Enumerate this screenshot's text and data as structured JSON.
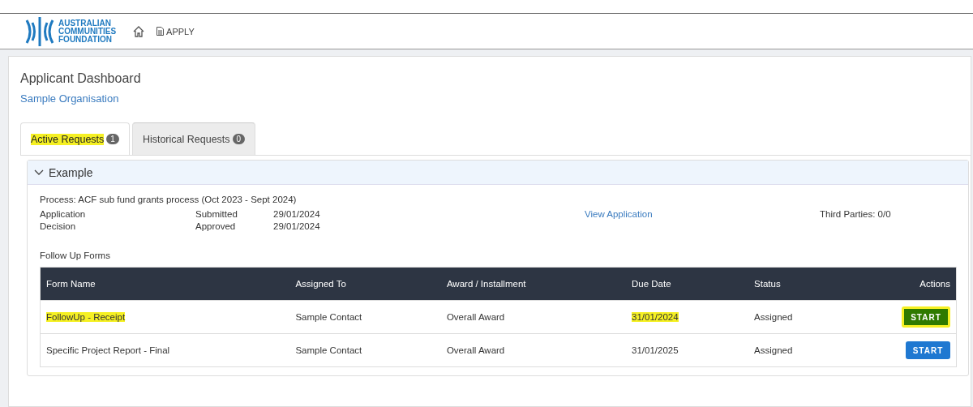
{
  "header": {
    "logo_lines": [
      "AUSTRALIAN",
      "COMMUNITIES",
      "FOUNDATION"
    ],
    "nav": [
      {
        "kind": "home"
      },
      {
        "kind": "link",
        "label": "APPLY"
      }
    ]
  },
  "page": {
    "title": "Applicant Dashboard",
    "organisation": "Sample Organisation"
  },
  "tabs": [
    {
      "label": "Active Requests",
      "count": "1",
      "selected": true,
      "highlighted": true
    },
    {
      "label": "Historical Requests",
      "count": "0",
      "selected": false,
      "highlighted": false
    }
  ],
  "section": {
    "title": "Example",
    "expanded": true,
    "process": "Process: ACF sub fund grants process (Oct 2023 - Sept 2024)",
    "stages": [
      {
        "name": "Application",
        "status": "Submitted",
        "date": "29/01/2024"
      },
      {
        "name": "Decision",
        "status": "Approved",
        "date": "29/01/2024"
      }
    ],
    "view_link": "View Application",
    "third_parties": "Third Parties: 0/0",
    "follow_up_label": "Follow Up Forms",
    "table": {
      "columns": [
        "Form Name",
        "Assigned To",
        "Award / Installment",
        "Due Date",
        "Status",
        "Actions"
      ],
      "rows": [
        {
          "form_name": "FollowUp - Receipt",
          "name_highlighted": true,
          "assigned_to": "Sample Contact",
          "award": "Overall Award",
          "due_date": "31/01/2024",
          "date_highlighted": true,
          "status": "Assigned",
          "action": "START",
          "action_highlighted": true
        },
        {
          "form_name": "Specific Project Report - Final",
          "name_highlighted": false,
          "assigned_to": "Sample Contact",
          "award": "Overall Award",
          "due_date": "31/01/2025",
          "date_highlighted": false,
          "status": "Assigned",
          "action": "START",
          "action_highlighted": false
        }
      ]
    }
  }
}
